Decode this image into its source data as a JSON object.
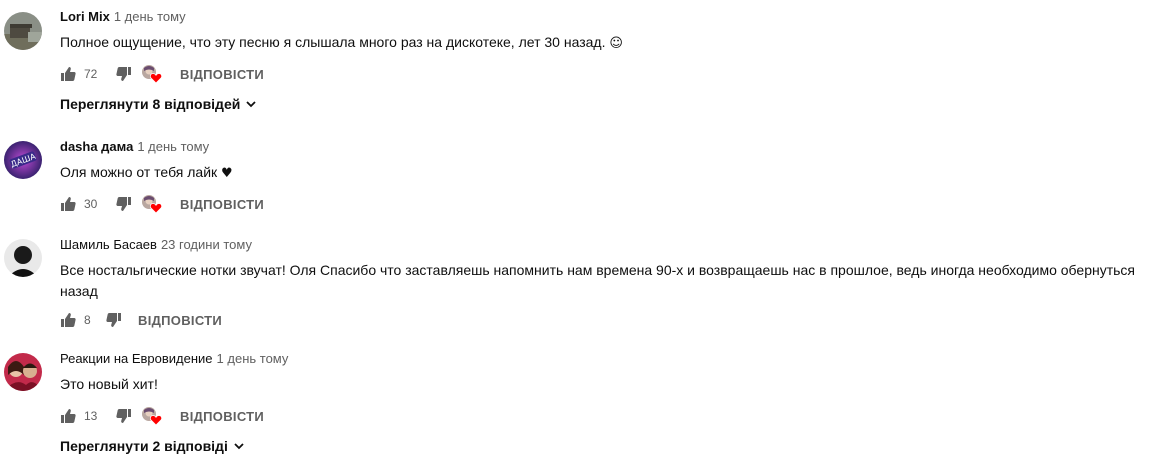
{
  "comments": [
    {
      "author": "Lori Mix",
      "time": "1 день тому",
      "text": "Полное ощущение, что эту песню я слышала много раз на дискотеке, лет 30 назад.",
      "emoji": "☺",
      "likes": "72",
      "reply_label": "ВІДПОВІСТИ",
      "replies_label": "Переглянути 8 відповідей"
    },
    {
      "author": "dasha дама",
      "time": "1 день тому",
      "text": "Оля можно от тебя лайк",
      "emoji": "♥",
      "likes": "30",
      "reply_label": "ВІДПОВІСТИ"
    },
    {
      "author": "Шамиль Басаев",
      "time": "23 години тому",
      "text": "Все ностальгические нотки звучат! Оля Спасибо что заставляешь напомнить нам времена 90-х и возвращаешь нас в прошлое, ведь иногда необходимо обернуться назад",
      "likes": "8",
      "reply_label": "ВІДПОВІСТИ"
    },
    {
      "author": "Реакции на Евровидение",
      "time": "1 день тому",
      "text": "Это новый хит!",
      "likes": "13",
      "reply_label": "ВІДПОВІСТИ",
      "replies_label": "Переглянути 2 відповіді"
    }
  ],
  "colors": {
    "text_primary": "#0f0f0f",
    "text_secondary": "#606060",
    "heart": "#ff0000"
  },
  "icons": [
    "like-icon",
    "dislike-icon",
    "heart-icon",
    "chevron-down-icon"
  ]
}
